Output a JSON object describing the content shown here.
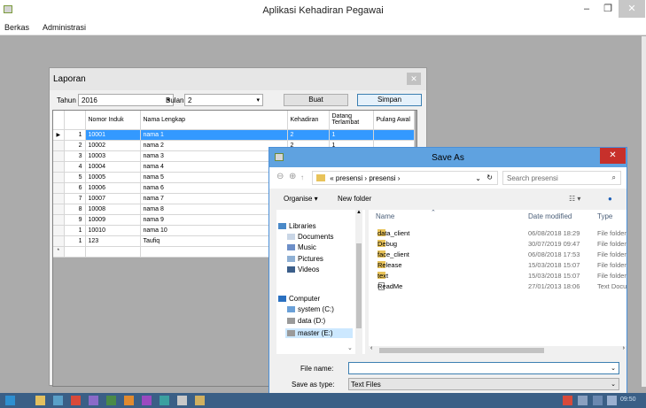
{
  "app": {
    "title": "Aplikasi Kehadiran Pegawai",
    "menu": [
      "Berkas",
      "Administrasi"
    ]
  },
  "laporan": {
    "title": "Laporan",
    "tahun_label": "Tahun",
    "tahun_value": "2016",
    "bulan_label": "Bulan",
    "bulan_value": "2",
    "buat_label": "Buat",
    "simpan_label": "Simpan",
    "columns": [
      "Nomor Induk",
      "Nama Lengkap",
      "Kehadiran",
      "Datang Terlambat",
      "Pulang Awal"
    ],
    "rows": [
      {
        "n": "1",
        "id": "10001",
        "nama": "nama 1",
        "hadir": "2",
        "telat": "1",
        "awal": ""
      },
      {
        "n": "2",
        "id": "10002",
        "nama": "nama 2",
        "hadir": "2",
        "telat": "1",
        "awal": ""
      },
      {
        "n": "3",
        "id": "10003",
        "nama": "nama 3",
        "hadir": "",
        "telat": "",
        "awal": ""
      },
      {
        "n": "4",
        "id": "10004",
        "nama": "nama 4",
        "hadir": "",
        "telat": "",
        "awal": ""
      },
      {
        "n": "5",
        "id": "10005",
        "nama": "nama 5",
        "hadir": "",
        "telat": "",
        "awal": ""
      },
      {
        "n": "6",
        "id": "10006",
        "nama": "nama 6",
        "hadir": "",
        "telat": "",
        "awal": ""
      },
      {
        "n": "7",
        "id": "10007",
        "nama": "nama 7",
        "hadir": "",
        "telat": "",
        "awal": ""
      },
      {
        "n": "8",
        "id": "10008",
        "nama": "nama 8",
        "hadir": "",
        "telat": "",
        "awal": ""
      },
      {
        "n": "9",
        "id": "10009",
        "nama": "nama 9",
        "hadir": "",
        "telat": "",
        "awal": ""
      },
      {
        "n": "1",
        "id": "10010",
        "nama": "nama 10",
        "hadir": "",
        "telat": "",
        "awal": ""
      },
      {
        "n": "1",
        "id": "123",
        "nama": "Taufiq",
        "hadir": "",
        "telat": "",
        "awal": ""
      }
    ],
    "new_row_marker": "*"
  },
  "save_as": {
    "title": "Save As",
    "path": [
      "«",
      "presensi",
      "›",
      "presensi",
      "›"
    ],
    "search_placeholder": "Search presensi",
    "organise_label": "Organise ▾",
    "new_folder_label": "New folder",
    "nav_items": [
      {
        "label": "Libraries",
        "icon": "libraries-icon"
      },
      {
        "label": "Documents",
        "icon": "documents-icon"
      },
      {
        "label": "Music",
        "icon": "music-icon"
      },
      {
        "label": "Pictures",
        "icon": "pictures-icon"
      },
      {
        "label": "Videos",
        "icon": "videos-icon"
      },
      {
        "label": "Computer",
        "icon": "computer-icon"
      },
      {
        "label": "system (C:)",
        "icon": "drive-icon"
      },
      {
        "label": "data (D:)",
        "icon": "drive-icon"
      },
      {
        "label": "master (E:)",
        "icon": "drive-icon"
      }
    ],
    "file_headers": {
      "name": "Name",
      "date": "Date modified",
      "type": "Type"
    },
    "files": [
      {
        "name": "data_client",
        "date": "06/08/2018 18:29",
        "type": "File folder",
        "kind": "folder"
      },
      {
        "name": "Debug",
        "date": "30/07/2019 09:47",
        "type": "File folder",
        "kind": "folder"
      },
      {
        "name": "face_client",
        "date": "06/08/2018 17:53",
        "type": "File folder",
        "kind": "folder"
      },
      {
        "name": "Release",
        "date": "15/03/2018 15:07",
        "type": "File folder",
        "kind": "folder"
      },
      {
        "name": "text",
        "date": "15/03/2018 15:07",
        "type": "File folder",
        "kind": "folder"
      },
      {
        "name": "ReadMe",
        "date": "27/01/2013 18:06",
        "type": "Text Docu",
        "kind": "text"
      }
    ],
    "file_name_label": "File name:",
    "file_name_value": "",
    "save_type_label": "Save as type:",
    "save_type_value": "Text Files"
  },
  "taskbar": {
    "clock": "09:50"
  }
}
